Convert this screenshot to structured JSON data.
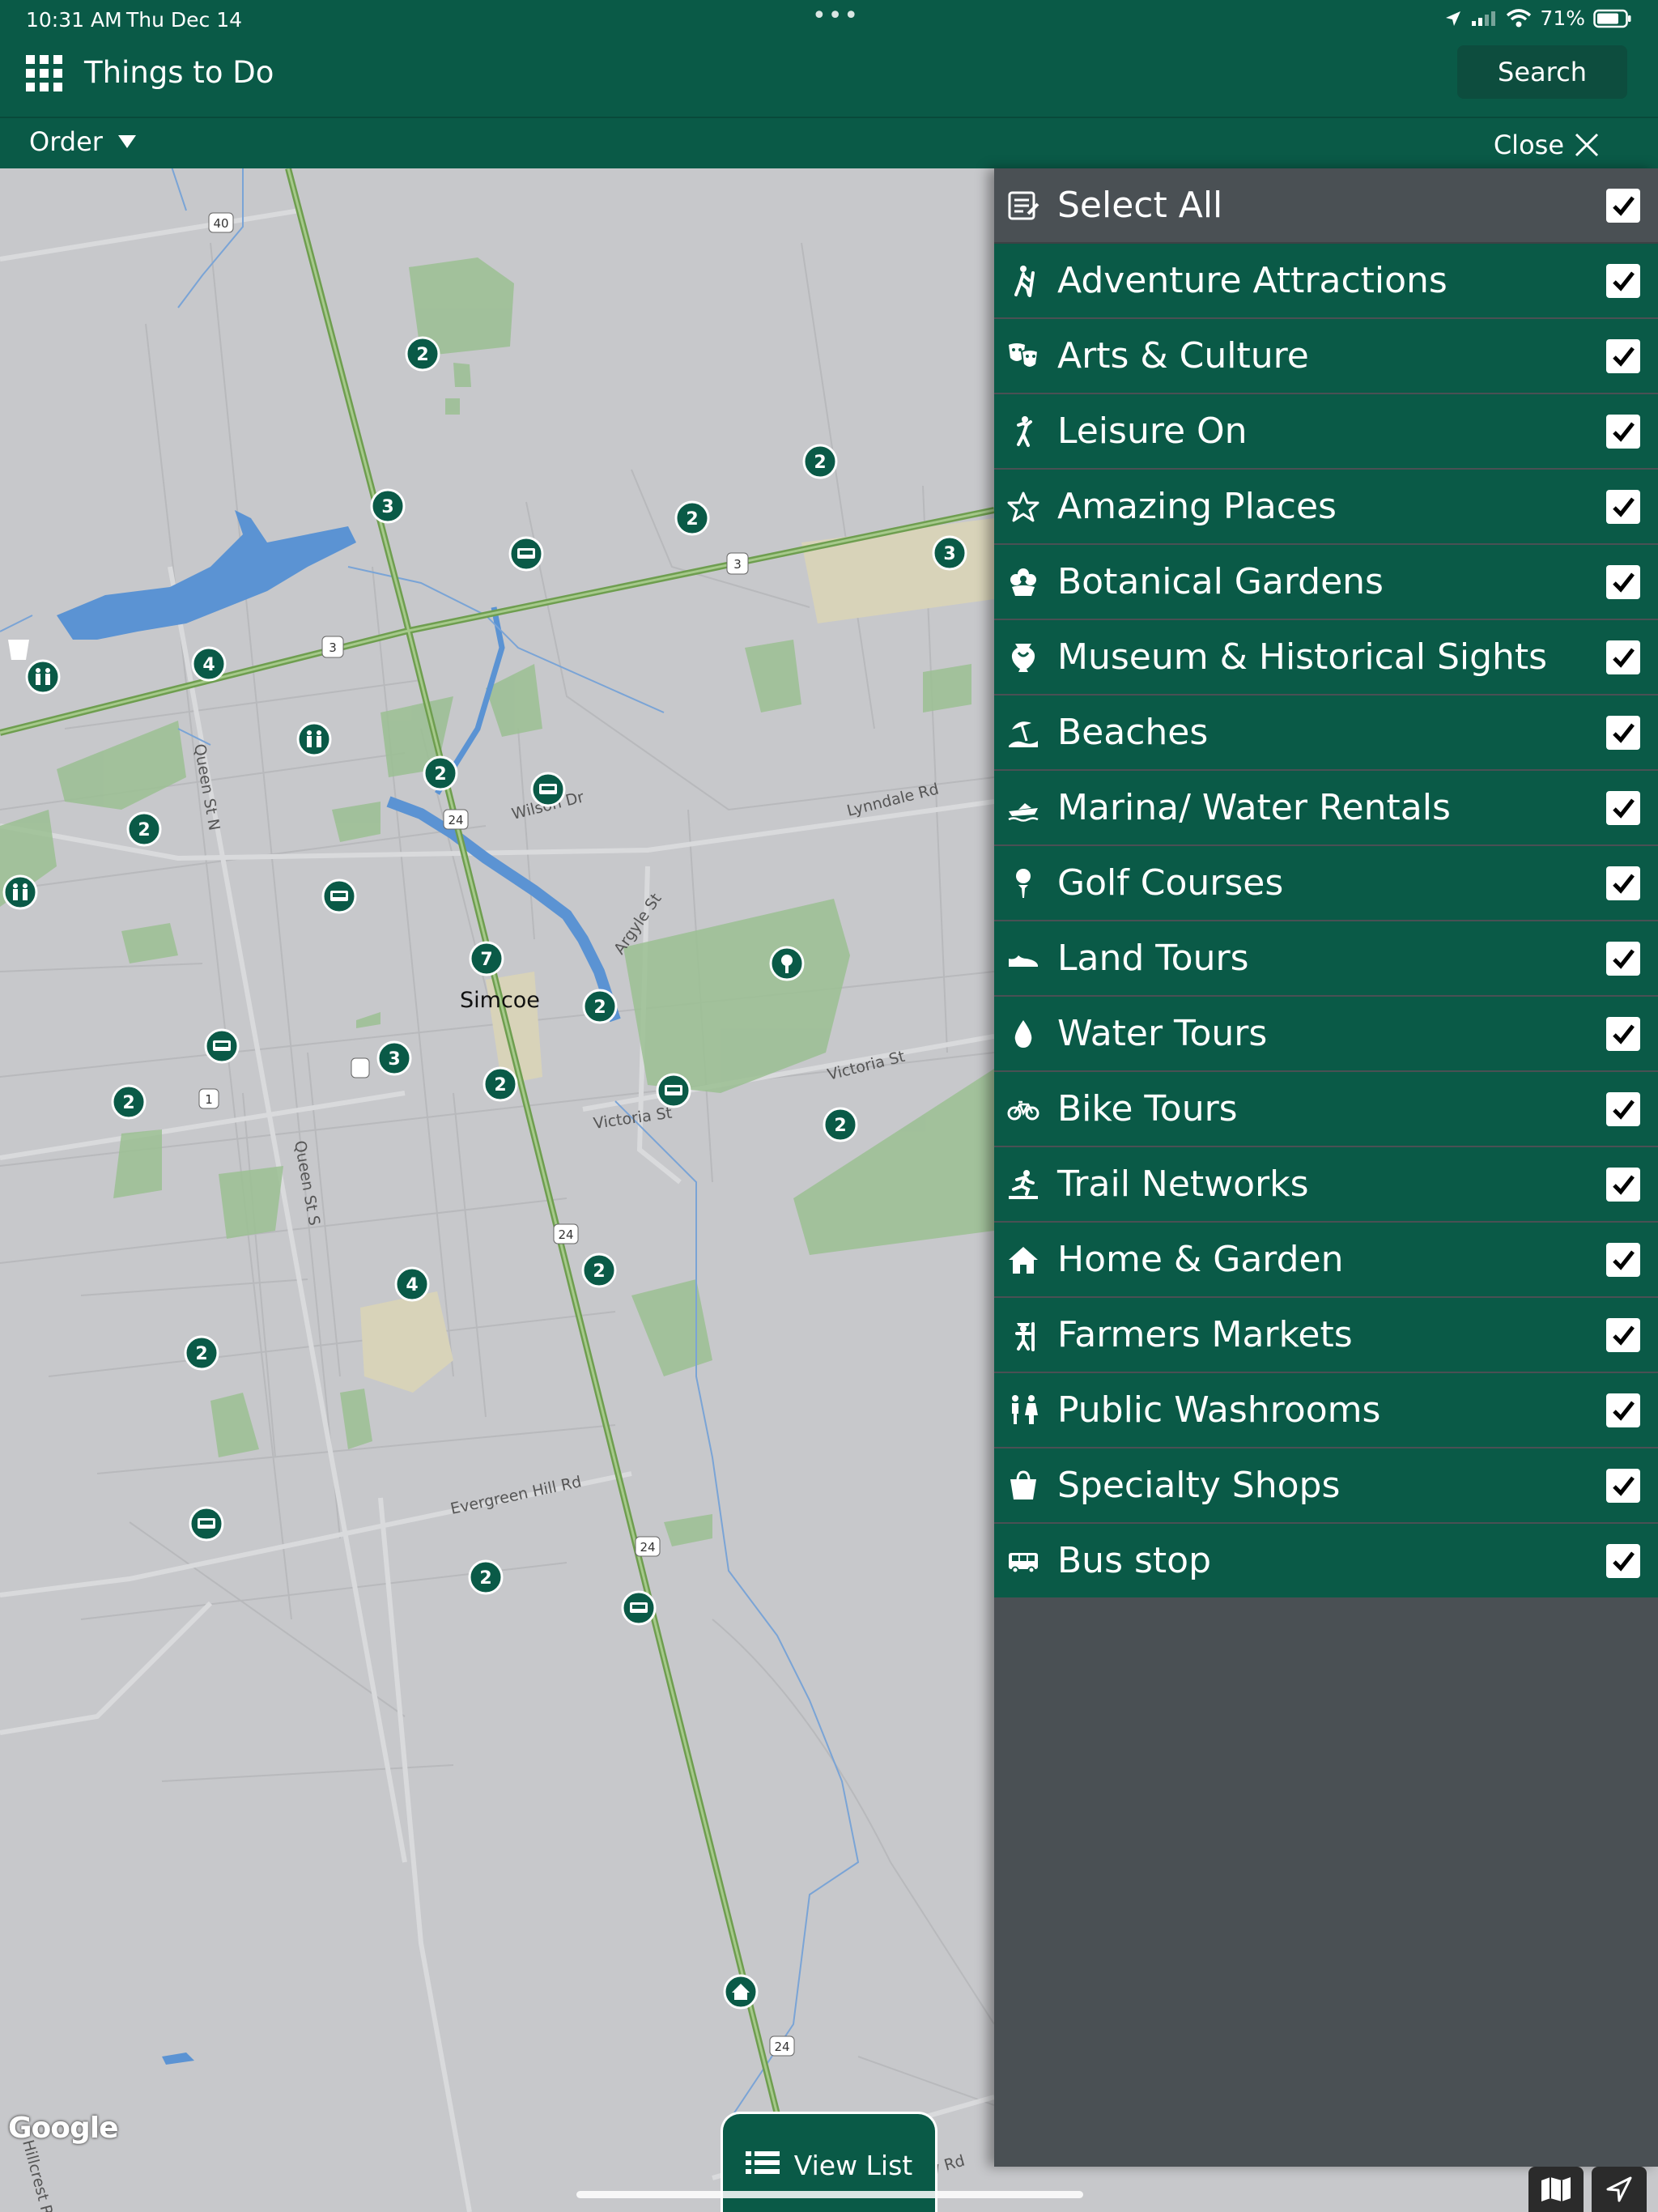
{
  "status_bar": {
    "time": "10:31 AM",
    "date": "Thu Dec 14",
    "battery": "71%"
  },
  "header": {
    "title": "Things to Do",
    "search_label": "Search",
    "order_label": "Order",
    "close_label": "Close"
  },
  "map": {
    "city_label": "Simcoe",
    "road_labels": [
      "Queen St N",
      "Queen St S",
      "Wilson Dr",
      "Lynndale Rd",
      "Argyle St",
      "Victoria St",
      "Victoria St",
      "Evergreen Hill Rd",
      "Lynn Valley Rd",
      "Hillcrest Rd"
    ],
    "shields": [
      "40",
      "3",
      "3",
      "24",
      "1",
      "24",
      "24",
      "24"
    ],
    "cluster_counts": [
      "2",
      "3",
      "2",
      "2",
      "3",
      "4",
      "2",
      "2",
      "7",
      "2",
      "3",
      "2",
      "2",
      "2",
      "4",
      "2",
      "2",
      "2"
    ],
    "attribution": "Google"
  },
  "filters": {
    "select_all": {
      "label": "Select All",
      "icon": "list-icon",
      "checked": true
    },
    "items": [
      {
        "label": "Adventure Attractions",
        "icon": "hiker-icon",
        "checked": true
      },
      {
        "label": "Arts & Culture",
        "icon": "theatre-masks-icon",
        "checked": true
      },
      {
        "label": "Leisure On",
        "icon": "person-leisure-icon",
        "checked": true
      },
      {
        "label": "Amazing Places",
        "icon": "star-icon",
        "checked": true
      },
      {
        "label": "Botanical Gardens",
        "icon": "flower-icon",
        "checked": true
      },
      {
        "label": "Museum & Historical Sights",
        "icon": "museum-vase-icon",
        "checked": true
      },
      {
        "label": "Beaches",
        "icon": "beach-umbrella-icon",
        "checked": true
      },
      {
        "label": "Marina/ Water Rentals",
        "icon": "boat-icon",
        "checked": true
      },
      {
        "label": "Golf Courses",
        "icon": "golf-tee-icon",
        "checked": true
      },
      {
        "label": "Land Tours",
        "icon": "shoe-icon",
        "checked": true
      },
      {
        "label": "Water Tours",
        "icon": "water-drop-icon",
        "checked": true
      },
      {
        "label": "Bike Tours",
        "icon": "bicycle-icon",
        "checked": true
      },
      {
        "label": "Trail Networks",
        "icon": "runner-icon",
        "checked": true
      },
      {
        "label": "Home & Garden",
        "icon": "house-icon",
        "checked": true
      },
      {
        "label": "Farmers Markets",
        "icon": "farmer-icon",
        "checked": true
      },
      {
        "label": "Public Washrooms",
        "icon": "washroom-icon",
        "checked": true
      },
      {
        "label": "Specialty Shops",
        "icon": "shopping-bag-icon",
        "checked": true
      },
      {
        "label": "Bus stop",
        "icon": "bus-icon",
        "checked": true
      }
    ]
  },
  "bottom": {
    "view_list_label": "View List"
  },
  "colors": {
    "brand_green": "#0a5a47",
    "panel_gray": "#4a5054",
    "map_background": "#c7c8cb",
    "park_green": "#9bbf93",
    "water_blue": "#5b93d3",
    "highway_green": "#6e9e4f"
  }
}
